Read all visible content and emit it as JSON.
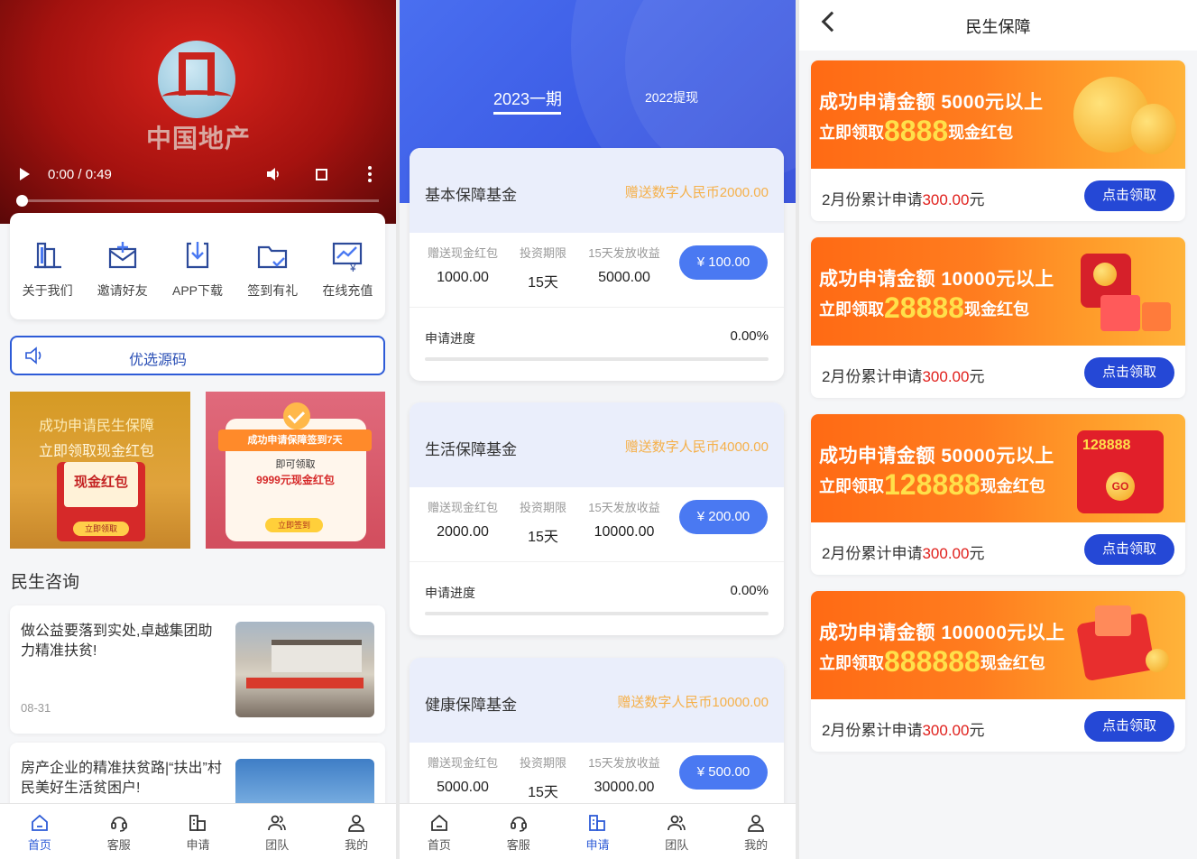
{
  "screen1": {
    "video": {
      "logo_text": "中国地产",
      "time": "0:00 / 0:49",
      "progress": 0
    },
    "quick_links": [
      {
        "label": "关于我们",
        "icon": "building-icon"
      },
      {
        "label": "邀请好友",
        "icon": "mail-add-icon"
      },
      {
        "label": "APP下载",
        "icon": "download-icon"
      },
      {
        "label": "签到有礼",
        "icon": "folder-check-icon"
      },
      {
        "label": "在线充值",
        "icon": "chart-yen-icon"
      }
    ],
    "notice": {
      "text": "优选源码"
    },
    "promo1": {
      "line1": "成功申请民生保障",
      "line2": "立即领取现金红包",
      "card": "现金红包",
      "button": "立即领取"
    },
    "promo2": {
      "ribbon": "成功申请保障签到7天",
      "line1": "即可领取",
      "line2": "9999元现金红包",
      "button": "立即签到"
    },
    "section_title": "民生咨询",
    "news": [
      {
        "title": "做公益要落到实处,卓越集团助力精准扶贫!",
        "date": "08-31"
      },
      {
        "title": "房产企业的精准扶贫路|“扶出”村民美好生活贫困户!",
        "date": ""
      }
    ]
  },
  "tabbar": {
    "items": [
      {
        "label": "首页",
        "icon": "home-icon"
      },
      {
        "label": "客服",
        "icon": "headset-icon"
      },
      {
        "label": "申请",
        "icon": "apply-icon"
      },
      {
        "label": "团队",
        "icon": "team-icon"
      },
      {
        "label": "我的",
        "icon": "user-icon"
      }
    ]
  },
  "screen2": {
    "tabs": [
      "2023一期",
      "2022提现"
    ],
    "col_labels": [
      "赠送现金红包",
      "投资期限",
      "15天发放收益"
    ],
    "progress_label": "申请进度",
    "funds": [
      {
        "name": "基本保障基金",
        "gift": "赠送数字人民币2000.00",
        "cash": "1000.00",
        "term": "15天",
        "income": "5000.00",
        "price": "¥ 100.00",
        "progress": "0.00%",
        "progress_value": 0
      },
      {
        "name": "生活保障基金",
        "gift": "赠送数字人民币4000.00",
        "cash": "2000.00",
        "term": "15天",
        "income": "10000.00",
        "price": "¥ 200.00",
        "progress": "0.00%",
        "progress_value": 0
      },
      {
        "name": "健康保障基金",
        "gift": "赠送数字人民币10000.00",
        "cash": "5000.00",
        "term": "15天",
        "income": "30000.00",
        "price": "¥ 500.00",
        "progress": "",
        "progress_value": 0
      }
    ]
  },
  "screen3": {
    "title": "民生保障",
    "foot_prefix": "2月份累计申请",
    "foot_amount": "300.00",
    "foot_suffix": "元",
    "claim_label": "点击领取",
    "bonuses": [
      {
        "line1": "成功申请金额 5000元以上",
        "pre": "立即领取",
        "big": "8888",
        "post": "现金红包"
      },
      {
        "line1": "成功申请金额 10000元以上",
        "pre": "立即领取",
        "big": "28888",
        "post": "现金红包"
      },
      {
        "line1": "成功申请金额 50000元以上",
        "pre": "立即领取",
        "big": "128888",
        "post": "现金红包",
        "deco_text": "128888",
        "deco_go": "GO"
      },
      {
        "line1": "成功申请金额 100000元以上",
        "pre": "立即领取",
        "big": "888888",
        "post": "现金红包"
      }
    ]
  },
  "colors": {
    "primary": "#2d5bd7",
    "fund_button": "#4a79f2",
    "gift_text": "#f5b04a",
    "claim_button": "#2548d6",
    "highlight_red": "#e0201c",
    "banner_orange": "#ff7d1f"
  }
}
